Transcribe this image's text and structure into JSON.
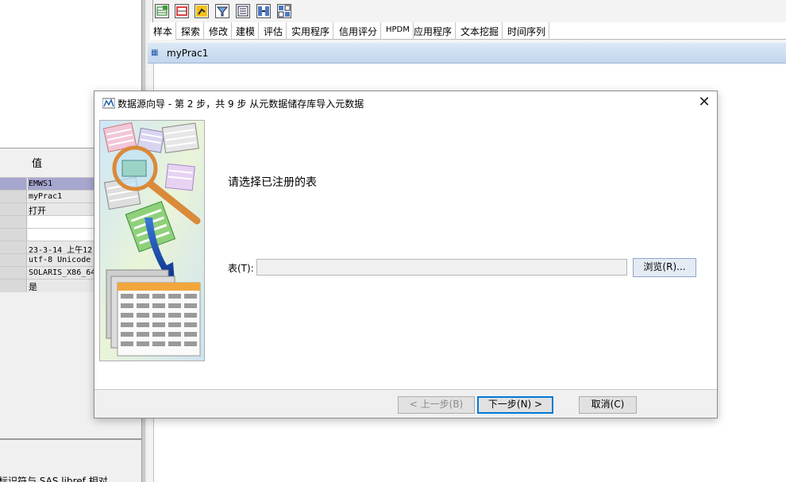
{
  "toolbar": {
    "icons": [
      "table-icon",
      "grid-icon",
      "chart-icon",
      "filter-icon",
      "list-icon",
      "merge-icon",
      "split-icon"
    ]
  },
  "tabs": [
    "样本",
    "探索",
    "修改",
    "建模",
    "评估",
    "实用程序",
    "信用评分",
    "HPDM",
    "应用程序",
    "文本挖掘",
    "时间序列"
  ],
  "mdi_window": {
    "title": "myPrac1"
  },
  "property_grid": {
    "value_header": "值",
    "rows": [
      "EMWS1",
      "myPrac1",
      "打开",
      "",
      "",
      "23-3-14 上午12",
      "utf-8  Unicode",
      "SOLARIS_X86_64",
      "是"
    ]
  },
  "description": "标识符与 SAS libref 相对",
  "dialog": {
    "title": "数据源向导 - 第 2 步，共 9 步 从元数据储存库导入元数据",
    "close": "✕",
    "prompt": "请选择已注册的表",
    "table_label": "表(T):",
    "table_value": "",
    "browse_button": "浏览(R)...",
    "back_button": "< 上一步(B)",
    "next_button": "下一步(N) >",
    "cancel_button": "取消(C)"
  }
}
